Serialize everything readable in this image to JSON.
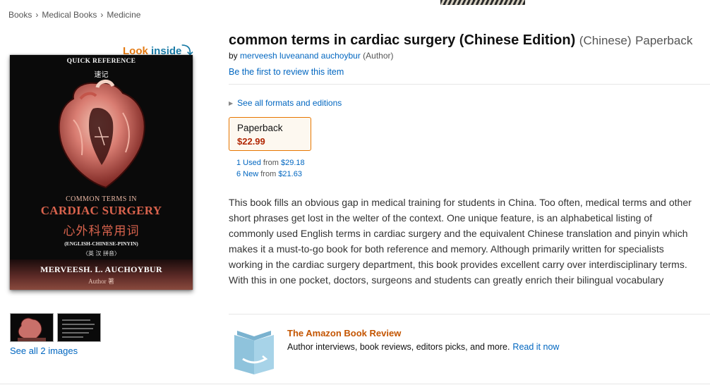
{
  "breadcrumb": [
    "Books",
    "Medical Books",
    "Medicine"
  ],
  "breadcrumb_sep": "›",
  "look_inside": {
    "look": "Look",
    "inside": "inside",
    "arrow": "⤵"
  },
  "cover": {
    "quick_ref": "QUICK REFERENCE",
    "quick_ref_cn": "速记",
    "common_terms": "COMMON TERMS IN",
    "cardiac_surgery": "CARDIAC SURGERY",
    "chinese_title": "心外科常用词",
    "subtitle": "(ENGLISH-CHINESE-PINYIN)",
    "pinyin_note": "〈英 汉 拼音〉",
    "author": "MERVEESH. L. AUCHOYBUR",
    "author_role": "Author 著"
  },
  "images": {
    "see_all": "See all 2 images"
  },
  "product": {
    "title": "common terms in cardiac surgery (Chinese Edition)",
    "language": "(Chinese)",
    "format": "Paperback",
    "by": "by",
    "author": "merveesh luveanand auchoybur",
    "author_role": "(Author)",
    "review_link": "Be the first to review this item",
    "see_formats": "See all formats and editions"
  },
  "format_option": {
    "name": "Paperback",
    "price": "$22.99"
  },
  "offers": [
    {
      "condition": "1 Used",
      "from": "from",
      "price": "$29.18"
    },
    {
      "condition": "6 New",
      "from": "from",
      "price": "$21.63"
    }
  ],
  "description": "This book fills an obvious gap in medical training for students in China. Too often, medical terms and other short phrases get lost in the welter of the context. One unique feature, is an alphabetical listing of commonly used English terms in cardiac surgery and the equivalent Chinese translation and pinyin which makes it a must-to-go book for both reference and memory. Although primarily written for specialists working in the cardiac surgery department, this book provides excellent carry over interdisciplinary terms. With this in one pocket, doctors, surgeons and students can greatly enrich their bilingual vocabulary",
  "book_review": {
    "title": "The Amazon Book Review",
    "text": "Author interviews, book reviews, editors picks, and more.",
    "link": "Read it now"
  },
  "colors": {
    "link": "#0066c0",
    "price": "#b12704",
    "accent_orange": "#e47911",
    "book_review_title": "#c45500"
  },
  "icons": [
    "look-inside-arrow-icon",
    "expand-triangle-icon",
    "open-book-icon"
  ]
}
